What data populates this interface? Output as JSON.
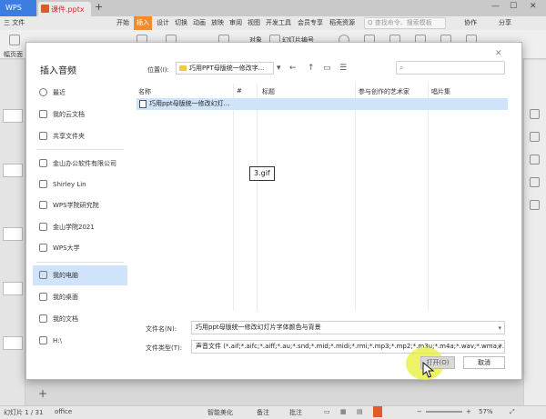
{
  "titlebar": {
    "app_tab": "WPS",
    "doc_tab": "课件.pptx",
    "new_tab": "+"
  },
  "menubar": {
    "file": "三 文件",
    "items": [
      "开始",
      "插入",
      "设计",
      "切换",
      "动画",
      "放映",
      "审阅",
      "视图",
      "开发工具",
      "会员专享",
      "稻壳资源"
    ],
    "search_placeholder": "Q 查找命令、搜索模板",
    "collab": "协作",
    "share": "分享"
  },
  "toolbar": {
    "left_label": "幅页面",
    "object": "对象",
    "slide_number": "幻灯片编号"
  },
  "dialog": {
    "title": "插入音频",
    "location_label": "位置(I):",
    "location_value": "巧用PPT母版统一修改字...",
    "sidebar": [
      {
        "label": "最近",
        "icon": "clock-icon"
      },
      {
        "label": "我的云文档",
        "icon": "cloud-icon"
      },
      {
        "label": "共享文件夹",
        "icon": "share-folder-icon"
      },
      {
        "label": "金山办公软件有限公司",
        "icon": "building-icon"
      },
      {
        "label": "Shirley Lin",
        "icon": "user-icon"
      },
      {
        "label": "WPS学院研究院",
        "icon": "building-icon"
      },
      {
        "label": "金山学院2021",
        "icon": "building-icon"
      },
      {
        "label": "WPS大学",
        "icon": "building-icon"
      },
      {
        "label": "我的电脑",
        "icon": "computer-icon"
      },
      {
        "label": "我的桌面",
        "icon": "desktop-icon"
      },
      {
        "label": "我的文档",
        "icon": "document-icon"
      },
      {
        "label": "H:\\",
        "icon": "drive-icon"
      }
    ],
    "columns": [
      "名称",
      "#",
      "标题",
      "参与创作的艺术家",
      "唱片集"
    ],
    "file_row": "巧用ppt母版统一修改幻灯...",
    "tooltip": "3.gif",
    "filename_label": "文件名(N):",
    "filename_value": "巧用ppt母版统一修改幻灯片字体颜色与背景",
    "filetype_label": "文件类型(T):",
    "filetype_value": "声音文件 (*.aif;*.aifc;*.aiff;*.au;*.snd;*.mid;*.midi;*.rmi;*.mp3;*.mp2;*.m3u;*.m4a;*.wav;*.wma;*.wax)",
    "open_button": "打开(O)",
    "cancel_button": "取消"
  },
  "statusbar": {
    "slide_info": "幻灯片 1 / 31",
    "theme": "office",
    "smart_beautify": "智能美化",
    "notes": "备注",
    "comment": "批注",
    "zoom": "57%"
  }
}
